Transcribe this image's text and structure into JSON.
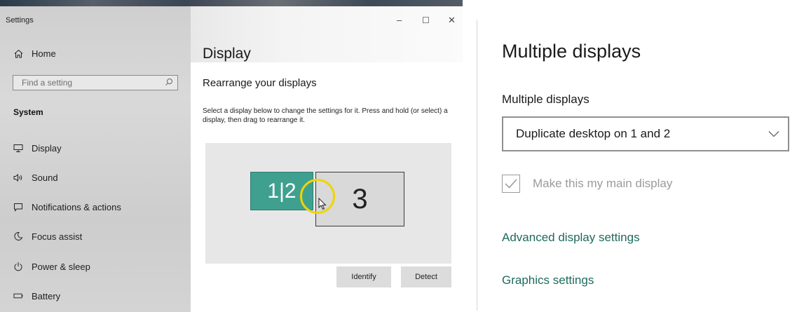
{
  "window": {
    "title": "Settings",
    "minimize_glyph": "–",
    "maximize_glyph": "☐",
    "close_glyph": "✕"
  },
  "sidebar": {
    "home": {
      "label": "Home",
      "icon": "home-icon"
    },
    "search": {
      "placeholder": "Find a setting",
      "icon": "search-icon"
    },
    "section": "System",
    "items": [
      {
        "label": "Display",
        "icon": "monitor-icon"
      },
      {
        "label": "Sound",
        "icon": "speaker-icon"
      },
      {
        "label": "Notifications & actions",
        "icon": "notification-icon"
      },
      {
        "label": "Focus assist",
        "icon": "moon-icon"
      },
      {
        "label": "Power & sleep",
        "icon": "power-icon"
      },
      {
        "label": "Battery",
        "icon": "battery-icon"
      }
    ]
  },
  "content": {
    "title": "Display",
    "subtitle": "Rearrange your displays",
    "description": "Select a display below to change the settings for it. Press and hold (or select) a display, then drag to rearrange it.",
    "monitors": [
      {
        "label": "1|2",
        "selected": true
      },
      {
        "label": "3",
        "selected": false
      }
    ],
    "identify_button": "Identify",
    "detect_button": "Detect",
    "colors": {
      "accent_monitor": "#40a090",
      "ring": "#f0d400"
    }
  },
  "zoom_panel": {
    "title": "Multiple displays",
    "dropdown_label": "Multiple displays",
    "dropdown_value": "Duplicate desktop on 1 and 2",
    "checkbox_label": "Make this my main display",
    "checkbox_checked": true,
    "checkbox_disabled": true,
    "link_advanced": "Advanced display settings",
    "link_graphics": "Graphics settings",
    "colors": {
      "link": "#1d6a5c"
    }
  }
}
